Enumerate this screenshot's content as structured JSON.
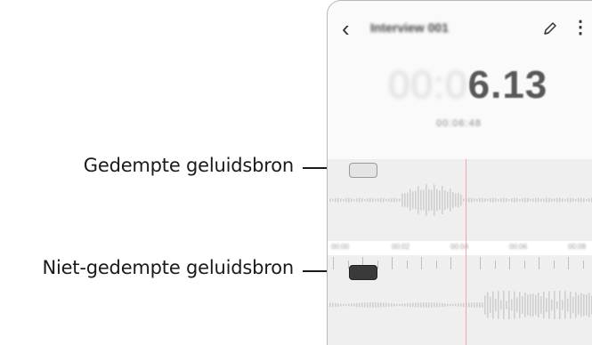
{
  "callouts": {
    "muted_label": "Gedempte geluidsbron",
    "unmuted_label": "Niet-gedempte geluidsbron"
  },
  "appbar": {
    "back_icon": "chevron-left-icon",
    "title": "Interview 001",
    "edit_icon": "pencil-icon",
    "more_icon": "more-vertical-icon"
  },
  "timer": {
    "dim_part": "00:0",
    "bright_part": "6.13",
    "sub_time": "00:06:48"
  },
  "timeline": {
    "tick_labels": [
      "00:00",
      "00:02",
      "00:04",
      "00:06",
      "00:08",
      "00:10"
    ]
  },
  "sources": [
    {
      "name": "muted",
      "state": "muted",
      "color": "#e4e4e4"
    },
    {
      "name": "unmuted",
      "state": "unmuted",
      "color": "#3a3a3a"
    }
  ],
  "colors": {
    "playhead": "#f2a5a5",
    "waveform": "#cfcfcf"
  }
}
